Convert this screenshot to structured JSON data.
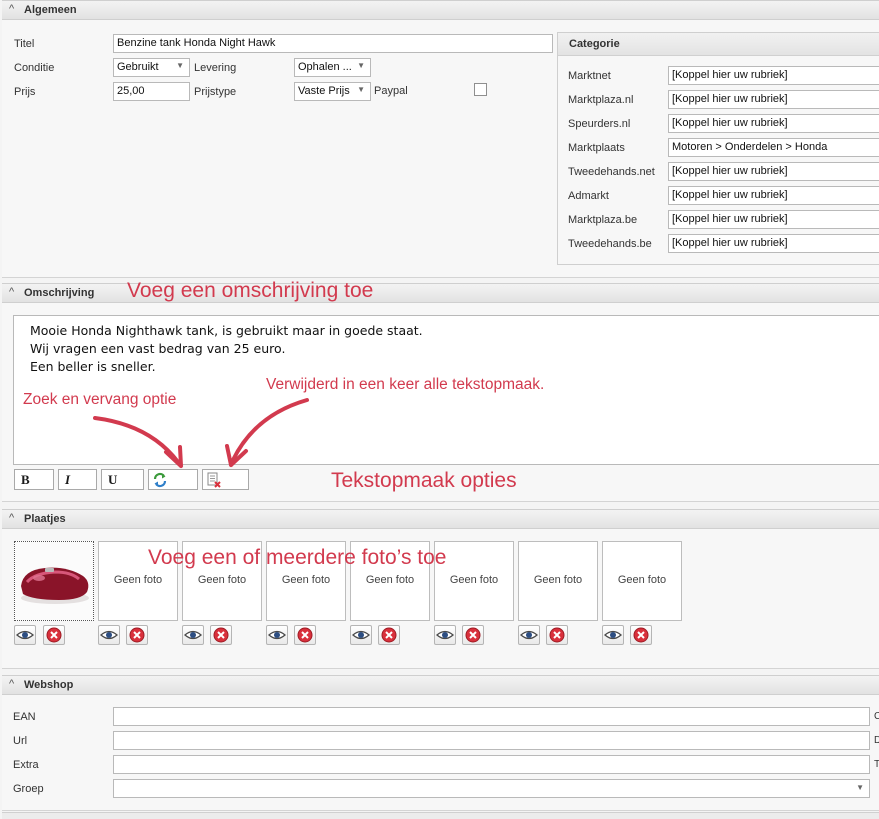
{
  "sections": {
    "algemeen": "Algemeen",
    "omschrijving": "Omschrijving",
    "plaatjes": "Plaatjes",
    "webshop": "Webshop"
  },
  "algemeen": {
    "titel_label": "Titel",
    "titel_value": "Benzine tank Honda Night Hawk",
    "conditie_label": "Conditie",
    "conditie_value": "Gebruikt",
    "levering_label": "Levering",
    "levering_value": "Ophalen ...",
    "prijs_label": "Prijs",
    "prijs_value": "25,00",
    "prijstype_label": "Prijstype",
    "prijstype_value": "Vaste Prijs",
    "paypal_label": "Paypal"
  },
  "categorie": {
    "title": "Categorie",
    "rows": [
      {
        "label": "Marktnet",
        "value": "[Koppel hier uw rubriek]"
      },
      {
        "label": "Marktplaza.nl",
        "value": "[Koppel hier uw rubriek]"
      },
      {
        "label": "Speurders.nl",
        "value": "[Koppel hier uw rubriek]"
      },
      {
        "label": "Marktplaats",
        "value": "Motoren > Onderdelen > Honda"
      },
      {
        "label": "Tweedehands.net",
        "value": "[Koppel hier uw rubriek]"
      },
      {
        "label": "Admarkt",
        "value": "[Koppel hier uw rubriek]"
      },
      {
        "label": "Marktplaza.be",
        "value": "[Koppel hier uw rubriek]"
      },
      {
        "label": "Tweedehands.be",
        "value": "[Koppel hier uw rubriek]"
      }
    ]
  },
  "omschrijving": {
    "lines": [
      "Mooie Honda Nighthawk tank, is gebruikt maar in goede staat.",
      "Wij vragen een vast bedrag van 25 euro.",
      "Een beller is sneller."
    ],
    "bold_label": "B",
    "italic_label": "I",
    "underline_label": "U"
  },
  "plaatjes": {
    "empty_label": "Geen foto"
  },
  "webshop": {
    "ean_label": "EAN",
    "url_label": "Url",
    "extra_label": "Extra",
    "groep_label": "Groep",
    "edge_letters": [
      "C",
      "D",
      "T"
    ]
  },
  "annotations": {
    "omschrijving": "Voeg een omschrijving toe",
    "zoek": "Zoek en vervang optie",
    "verwijderd": "Verwijderd in een keer alle tekstopmaak.",
    "tekstopmaak": "Tekstopmaak opties",
    "fotos": "Voeg een of meerdere foto’s toe"
  },
  "colors": {
    "annotation": "#d23a4e",
    "delete_icon": "#d9303c"
  }
}
